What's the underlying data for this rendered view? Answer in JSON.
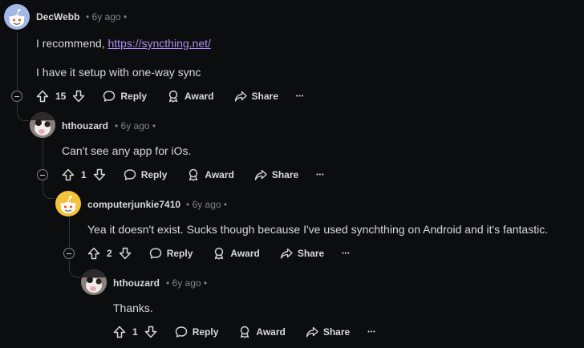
{
  "comments": [
    {
      "username": "DecWebb",
      "age": "6y ago",
      "body_prefix": "I recommend, ",
      "link": "https://syncthing.net/",
      "body_line2": "I have it setup with one-way sync",
      "score": "15",
      "avatar": "reddit-snoo-default-blue"
    },
    {
      "username": "hthouzard",
      "age": "6y ago",
      "body": "Can't see any app for iOs.",
      "score": "1",
      "avatar": "user-photo"
    },
    {
      "username": "computerjunkie7410",
      "age": "6y ago",
      "body": "Yea it doesn't exist. Sucks though because I've used synchthing on Android and it's fantastic.",
      "score": "2",
      "avatar": "reddit-snoo-default-yellow"
    },
    {
      "username": "hthouzard",
      "age": "6y ago",
      "body": "Thanks.",
      "score": "1",
      "avatar": "user-photo"
    }
  ],
  "labels": {
    "reply": "Reply",
    "award": "Award",
    "share": "Share",
    "more": "•••",
    "dot": "•"
  },
  "colors": {
    "background": "#0b0d0e",
    "text": "#d7dadc",
    "meta": "#818384",
    "link": "#b28cf0",
    "avatar_blue": "#a3b8e6",
    "avatar_yellow": "#f5c33b"
  }
}
